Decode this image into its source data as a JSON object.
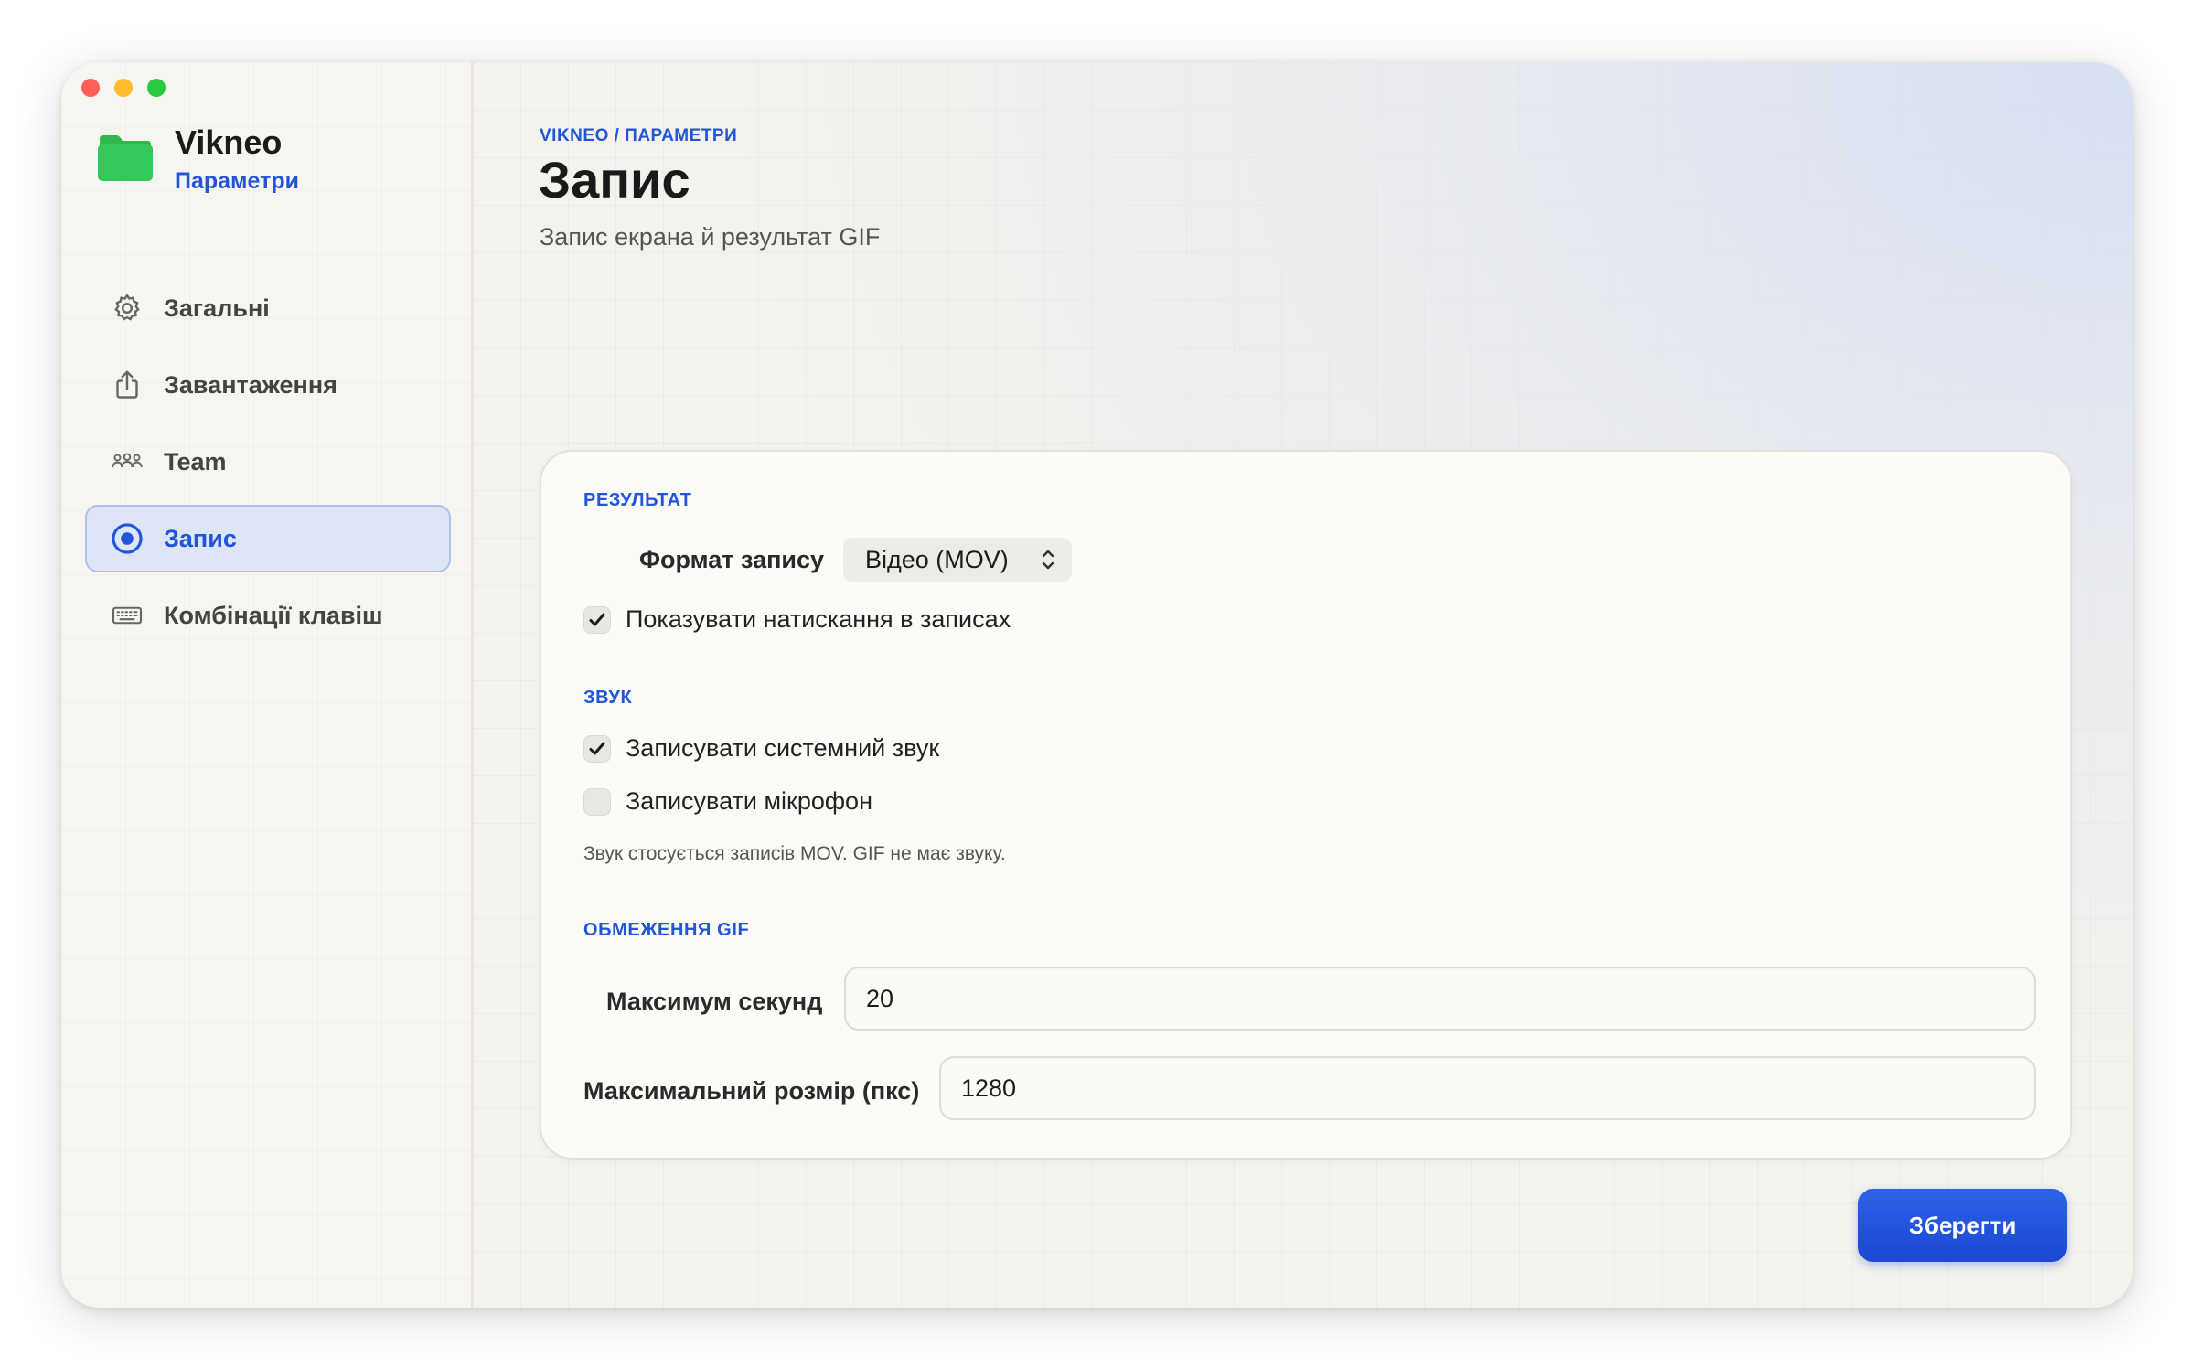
{
  "app": {
    "name": "Vikneo",
    "subtitle": "Параметри"
  },
  "sidebar": {
    "items": [
      {
        "label": "Загальні",
        "icon": "gear-icon",
        "active": false
      },
      {
        "label": "Завантаження",
        "icon": "share-upload-icon",
        "active": false
      },
      {
        "label": "Team",
        "icon": "people-icon",
        "active": false
      },
      {
        "label": "Запис",
        "icon": "record-icon",
        "active": true
      },
      {
        "label": "Комбінації клавіш",
        "icon": "keyboard-icon",
        "active": false
      }
    ]
  },
  "header": {
    "breadcrumb": "VIKNEO / ПАРАМЕТРИ",
    "title": "Запис",
    "subtitle": "Запис екрана й результат GIF"
  },
  "sections": {
    "result": {
      "heading": "РЕЗУЛЬТАТ",
      "format_label": "Формат запису",
      "format_value": "Відео (MOV)",
      "show_clicks_label": "Показувати натискання в записах",
      "show_clicks_checked": true
    },
    "sound": {
      "heading": "ЗВУК",
      "system_audio_label": "Записувати системний звук",
      "system_audio_checked": true,
      "microphone_label": "Записувати мікрофон",
      "microphone_checked": false,
      "hint": "Звук стосується записів MOV. GIF не має звуку."
    },
    "gif_limits": {
      "heading": "ОБМЕЖЕННЯ GIF",
      "max_seconds_label": "Максимум секунд",
      "max_seconds_value": "20",
      "max_size_label": "Максимальний розмір (пкс)",
      "max_size_value": "1280"
    }
  },
  "footer": {
    "save_label": "Зберегти"
  },
  "colors": {
    "accent": "#2255d9",
    "window_bg": "#f7f6f1",
    "button": "#1f4fdb",
    "folder": "#34c759"
  }
}
